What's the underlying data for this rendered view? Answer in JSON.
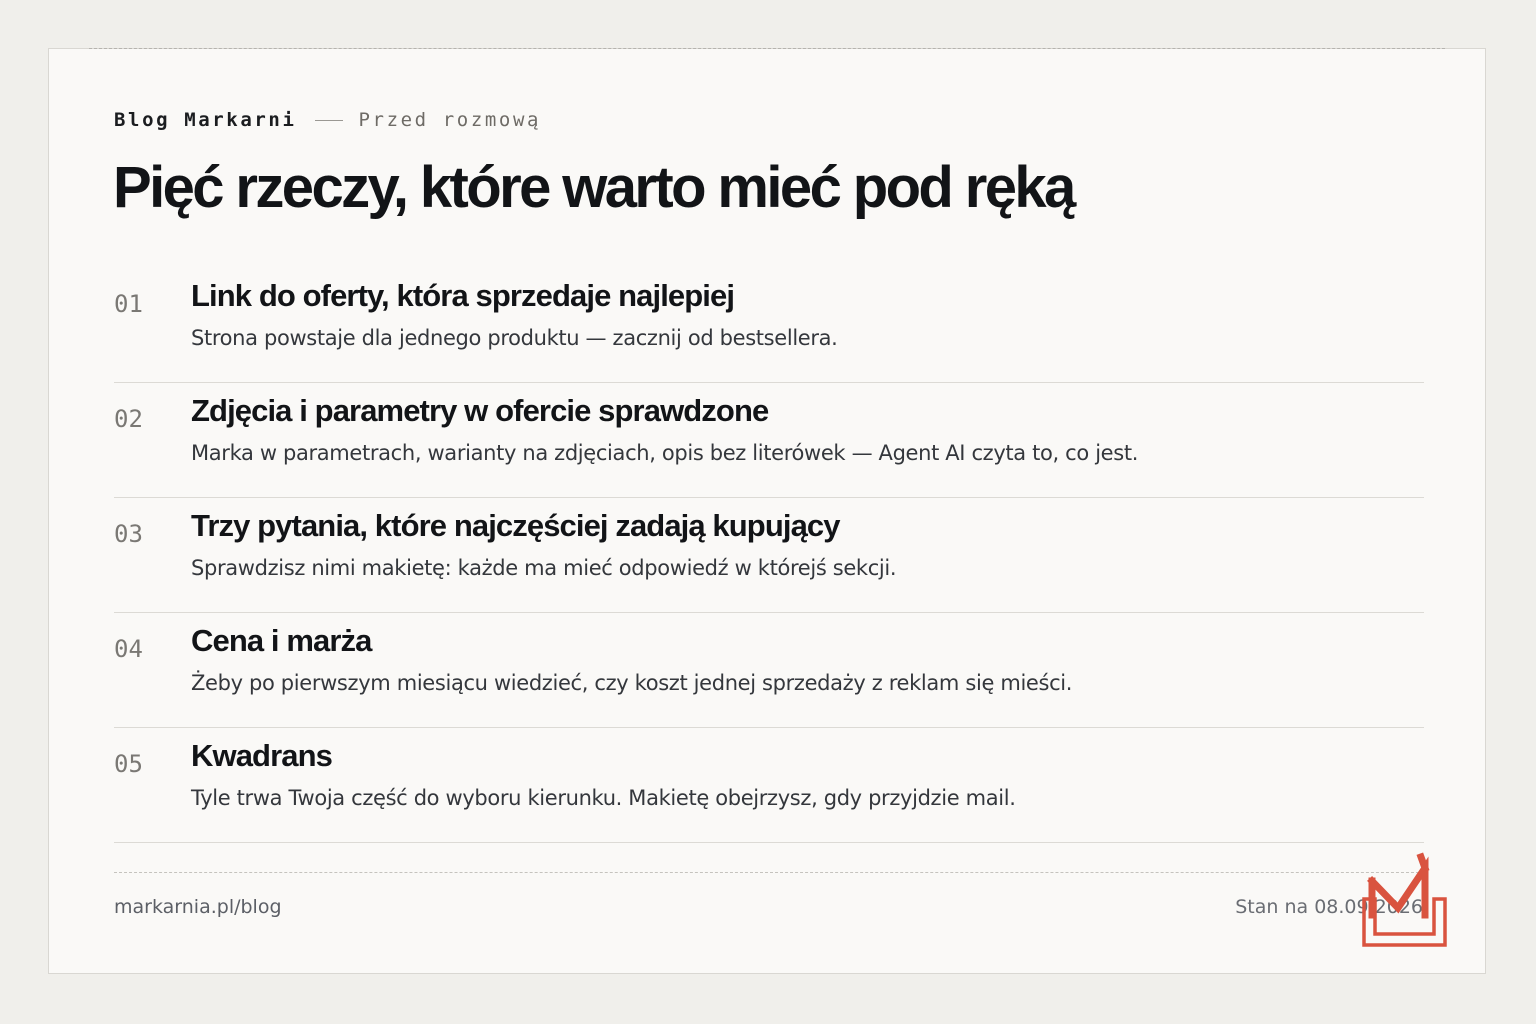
{
  "header": {
    "brand": "Blog Markarni",
    "section": "Przed rozmową",
    "title": "Pięć rzeczy, które warto mieć pod ręką"
  },
  "items": [
    {
      "number": "01",
      "title": "Link do oferty, która sprzedaje najlepiej",
      "description": "Strona powstaje dla jednego produktu — zacznij od bestsellera."
    },
    {
      "number": "02",
      "title": "Zdjęcia i parametry w ofercie sprawdzone",
      "description": "Marka w parametrach, warianty na zdjęciach, opis bez literówek — Agent AI czyta to, co jest."
    },
    {
      "number": "03",
      "title": "Trzy pytania, które najczęściej zadają kupujący",
      "description": "Sprawdzisz nimi makietę: każde ma mieć odpowiedź w którejś sekcji."
    },
    {
      "number": "04",
      "title": "Cena i marża",
      "description": "Żeby po pierwszym miesiącu wiedzieć, czy koszt jednej sprzedaży z reklam się mieści."
    },
    {
      "number": "05",
      "title": "Kwadrans",
      "description": "Tyle trwa Twoja część do wyboru kierunku. Makietę obejrzysz, gdy przyjdzie mail."
    }
  ],
  "footer": {
    "url": "markarnia.pl/blog",
    "date_label": "Stan na 08.09.2026"
  },
  "logo": {
    "icon": "markarnia-m-logo-icon",
    "color": "#d9533f"
  },
  "colors": {
    "page_background": "#f0efeb",
    "card_background": "#faf9f7",
    "text_primary": "#121417",
    "accent": "#d9533f"
  }
}
